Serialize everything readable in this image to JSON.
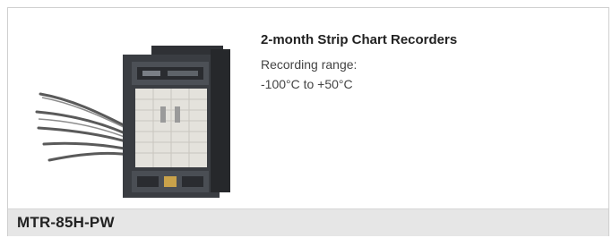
{
  "product": {
    "title": "2-month Strip Chart Recorders",
    "details": [
      "Recording range:",
      "-100°C to +50°C"
    ],
    "model": "MTR-85H-PW",
    "image_name": "strip-chart-recorder-photo"
  },
  "colors": {
    "card_border": "#cfcfcf",
    "footer_bg": "#e6e6e6",
    "text_dark": "#222222",
    "text_body": "#444444"
  }
}
